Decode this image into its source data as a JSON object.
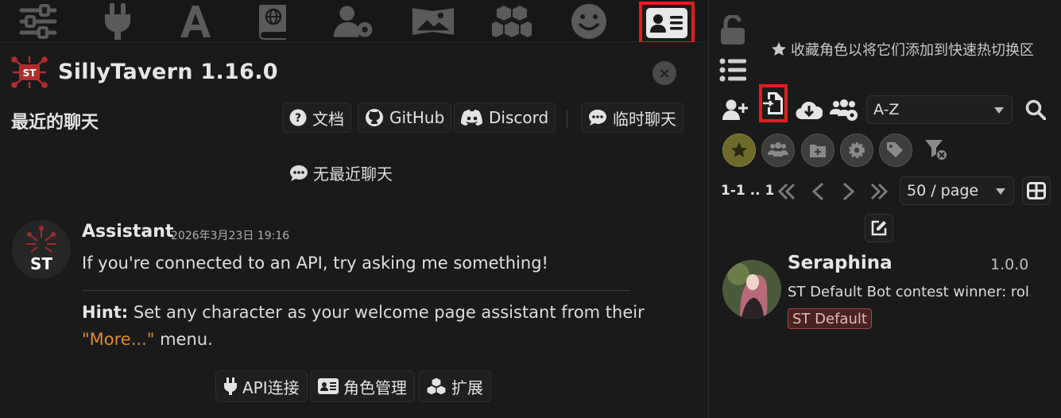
{
  "topbar": {
    "icons": [
      "sliders-icon",
      "plug-icon",
      "font-icon",
      "book-atlas-icon",
      "user-gear-icon",
      "panorama-icon",
      "cubes-icon",
      "smiley-icon",
      "address-card-icon"
    ],
    "active_icon": "address-card-icon"
  },
  "header": {
    "app_title": "SillyTavern 1.16.0",
    "logo_text": "ST",
    "close_glyph": "×"
  },
  "recent": {
    "title": "最近的聊天",
    "links": [
      {
        "label": "文档",
        "icon": "question-circle-icon"
      },
      {
        "label": "GitHub",
        "icon": "github-icon"
      },
      {
        "label": "Discord",
        "icon": "discord-icon"
      },
      {
        "label": "临时聊天",
        "icon": "comment-dots-icon"
      }
    ],
    "empty_label": "无最近聊天"
  },
  "message": {
    "name": "Assistant",
    "timestamp": "2026年3月23日 19:16",
    "avatar_text": "ST",
    "text": "If you're connected to an API, try asking me something!",
    "hint_label": "Hint:",
    "hint_part1": "Set any character as your welcome page assistant from their",
    "hint_link": "\"More...\"",
    "hint_part2": "menu."
  },
  "bottom_buttons": [
    {
      "label": "API连接",
      "icon": "plug-icon"
    },
    {
      "label": "角色管理",
      "icon": "address-card-icon"
    },
    {
      "label": "扩展",
      "icon": "cubes-icon"
    }
  ],
  "right_panel": {
    "favorite_hint": "收藏角色以将它们添加到快速热切换区",
    "sort_value": "A-Z",
    "pagination": {
      "info": "1-1 .. 1",
      "page_size": "50 / page"
    },
    "filters": [
      "star-icon",
      "users-icon",
      "folder-plus-icon",
      "gear-icon",
      "tags-icon"
    ],
    "active_button": "import-character-icon",
    "character": {
      "name": "Seraphina",
      "version": "1.0.0",
      "description": "ST Default Bot contest winner: rol...",
      "tag": "ST Default"
    }
  },
  "colors": {
    "accent_link": "#e08a22",
    "highlight": "#e01e1e",
    "background": "#1a1a1a"
  }
}
